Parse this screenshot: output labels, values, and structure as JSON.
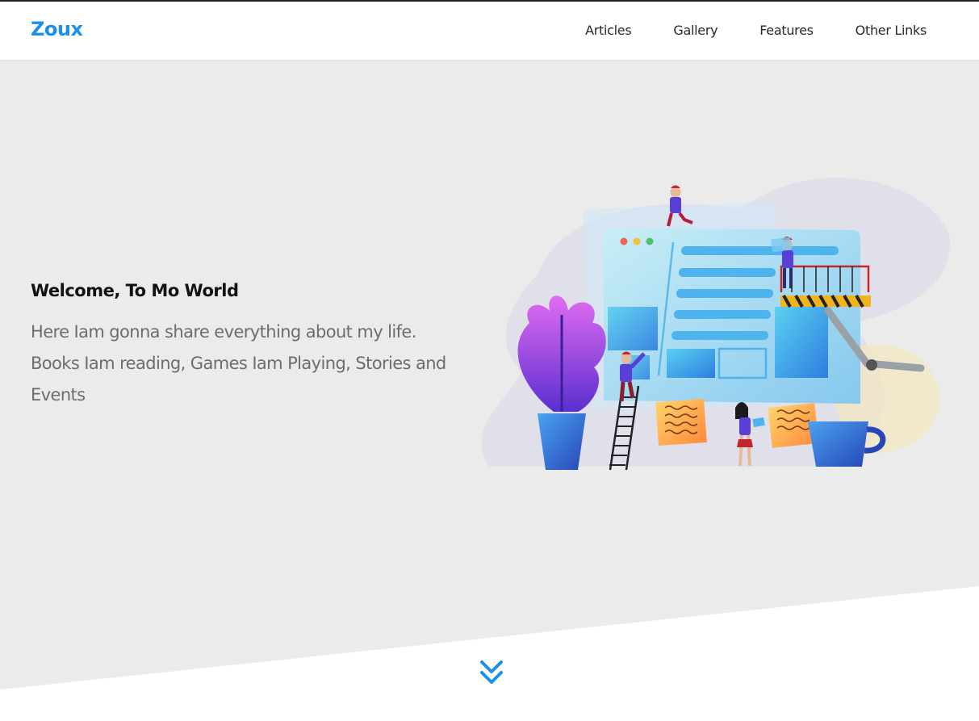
{
  "brand": {
    "name": "Zoux",
    "color": "#1e90e8"
  },
  "nav": {
    "items": [
      {
        "label": "Articles"
      },
      {
        "label": "Gallery"
      },
      {
        "label": "Features"
      },
      {
        "label": "Other Links"
      }
    ]
  },
  "hero": {
    "heading": "Welcome, To Mo World",
    "description": "Here Iam gonna share everything about my life. Books Iam reading, Games Iam Playing, Stories and Events",
    "illustration": "team-building-website-illustration",
    "scroll_icon": "double-chevron-down-icon"
  },
  "colors": {
    "accent": "#1e90e8",
    "hero_bg": "#ebebeb",
    "text_dark": "#111111",
    "text_muted": "#6d6d6d"
  }
}
